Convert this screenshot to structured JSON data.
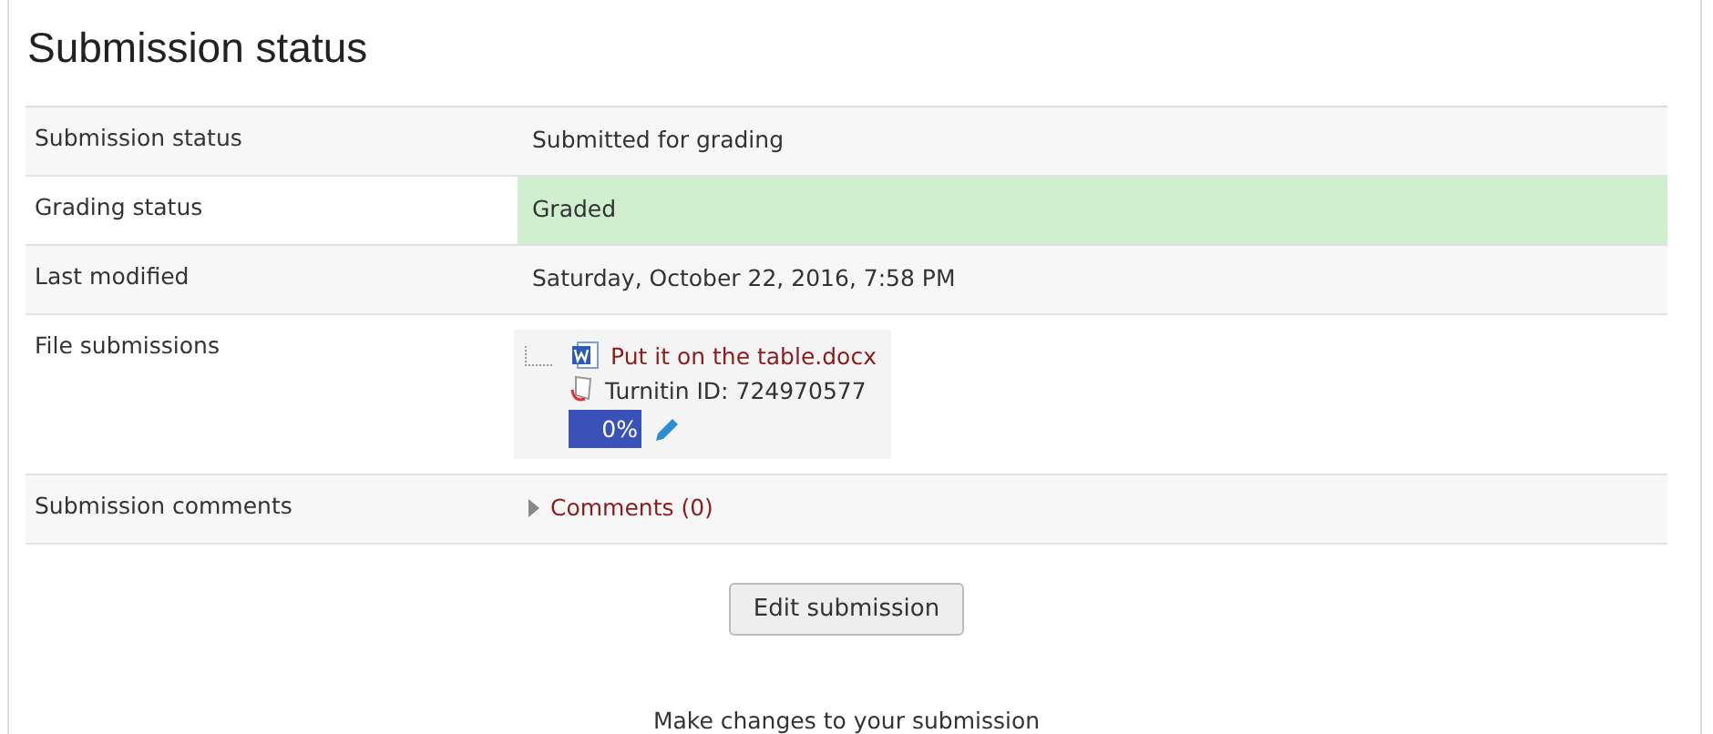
{
  "title": "Submission status",
  "rows": [
    {
      "kind": "text",
      "label": "Submission status",
      "value": "Submitted for grading",
      "highlighted": false
    },
    {
      "kind": "text",
      "label": "Grading status",
      "value": "Graded",
      "highlighted": true
    },
    {
      "kind": "text",
      "label": "Last modified",
      "value": "Saturday, October 22, 2016, 7:58 PM",
      "highlighted": false
    },
    {
      "kind": "files",
      "label": "File submissions",
      "file": "Put it on the table.docx",
      "turnitin": "Turnitin ID: 724970577",
      "score": "0%"
    },
    {
      "kind": "comments",
      "label": "Submission comments",
      "link": "Comments (0)",
      "expanded": false
    }
  ],
  "button": "Edit submission",
  "help": "Make changes to your submission"
}
